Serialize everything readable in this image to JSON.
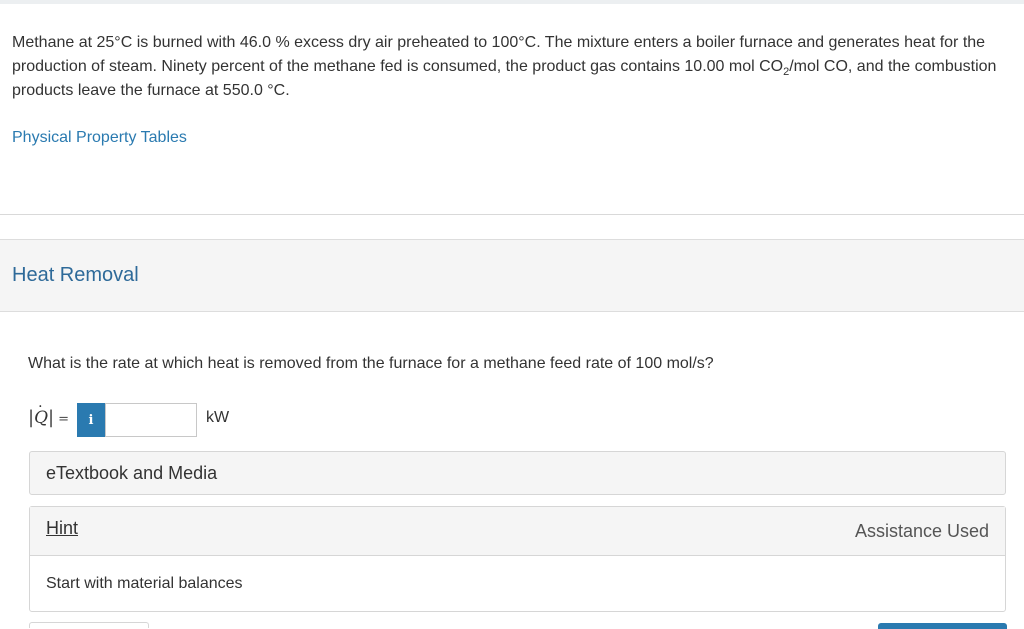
{
  "problem": {
    "text_before_sub": "Methane at 25°C is burned with 46.0 % excess dry air preheated to 100°C. The mixture enters a boiler furnace and generates heat for the production of steam. Ninety percent of the methane fed is consumed, the product gas contains 10.00 mol CO",
    "subscript": "2",
    "text_after_sub": "/mol CO, and the combustion products leave the furnace at 550.0 °C."
  },
  "links": {
    "property_tables": "Physical Property Tables"
  },
  "section": {
    "title": "Heat Removal"
  },
  "question": {
    "text": "What is the rate at which heat is removed from the furnace for a methane feed rate of 100 mol/s?",
    "variable_label": "Q",
    "equals": "=",
    "info_button": "i",
    "input_value": "",
    "unit": "kW"
  },
  "panels": {
    "etextbook": "eTextbook and Media",
    "hint_label": "Hint",
    "assistance_status": "Assistance Used",
    "hint_text": "Start with material balances"
  },
  "colors": {
    "link": "#2a7ab0",
    "section_title": "#2e6a99",
    "panel_bg": "#f5f5f5"
  }
}
